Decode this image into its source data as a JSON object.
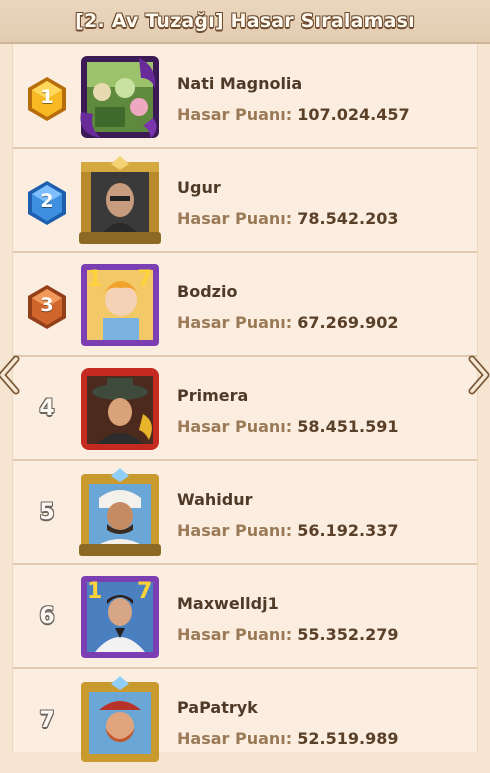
{
  "header": {
    "title": "[2. Av Tuzağı] Hasar Sıralaması"
  },
  "score_label": "Hasar Puanı:",
  "rows": [
    {
      "rank": "1",
      "name": "Nati Magnolia",
      "score": "107.024.457",
      "medal": "gold",
      "portrait": "jungle-avatar-purple-frame"
    },
    {
      "rank": "2",
      "name": "Ugur",
      "score": "78.542.203",
      "medal": "blue",
      "portrait": "photo-avatar-gold-frame"
    },
    {
      "rank": "3",
      "name": "Bodzio",
      "score": "67.269.902",
      "medal": "bronze",
      "portrait": "blonde-hero-avatar"
    },
    {
      "rank": "4",
      "name": "Primera",
      "score": "58.451.591",
      "medal": "none",
      "portrait": "hat-hero-red-frame"
    },
    {
      "rank": "5",
      "name": "Wahidur",
      "score": "56.192.337",
      "medal": "none",
      "portrait": "desert-hero-gold-frame"
    },
    {
      "rank": "6",
      "name": "Maxwelldj1",
      "score": "55.352.279",
      "medal": "none",
      "portrait": "suited-hero-avatar"
    },
    {
      "rank": "7",
      "name": "PaPatryk",
      "score": "52.519.989",
      "medal": "none",
      "portrait": "redbeard-hero-gold-frame"
    }
  ],
  "colors": {
    "gold": "#f2b11f",
    "blue": "#3f8fe0",
    "bronze": "#d0662c",
    "text_dark": "#4f3a28"
  }
}
